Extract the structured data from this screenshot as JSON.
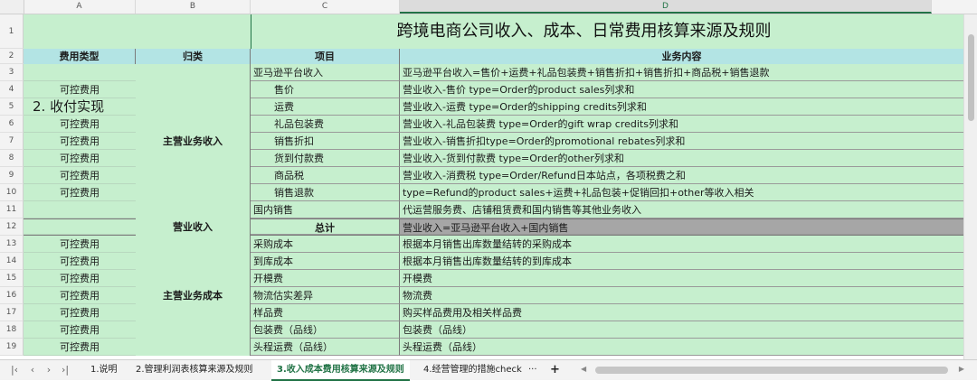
{
  "sheet_title": "跨境电商公司收入、成本、日常费用核算来源及规则",
  "column_headers": [
    "A",
    "B",
    "C",
    "D"
  ],
  "header_row": {
    "col_a": "费用类型",
    "col_b": "归类",
    "col_c": "项目",
    "col_d": "业务内容"
  },
  "section_label": "2.  收付实现",
  "merged_labels": {
    "income": "主营业务收入",
    "revenue": "营业收入",
    "cost": "主营业务成本"
  },
  "rows": [
    {
      "num": "1"
    },
    {
      "num": "2"
    },
    {
      "num": "3",
      "a": "",
      "c": "亚马逊平台收入",
      "d": "亚马逊平台收入=售价+运费+礼品包装费+销售折扣+销售折扣+商品税+销售退款"
    },
    {
      "num": "4",
      "a": "可控费用",
      "c": "售价",
      "d": "营业收入-售价 type=Order的product sales列求和"
    },
    {
      "num": "5",
      "a": "",
      "c": "运费",
      "d": "营业收入-运费 type=Order的shipping credits列求和"
    },
    {
      "num": "6",
      "a": "可控费用",
      "c": "礼品包装费",
      "d": "营业收入-礼品包装费 type=Order的gift wrap credits列求和"
    },
    {
      "num": "7",
      "a": "可控费用",
      "c": "销售折扣",
      "d": "营业收入-销售折扣type=Order的promotional rebates列求和"
    },
    {
      "num": "8",
      "a": "可控费用",
      "c": "货到付款费",
      "d": "营业收入-货到付款费 type=Order的other列求和"
    },
    {
      "num": "9",
      "a": "可控费用",
      "c": "商品税",
      "d": "营业收入-消费税 type=Order/Refund日本站点，各项税费之和"
    },
    {
      "num": "10",
      "a": "可控费用",
      "c": "销售退款",
      "d": "type=Refund的product sales+运费+礼品包装+促销回扣+other等收入相关"
    },
    {
      "num": "11",
      "a": "",
      "c": "国内销售",
      "d": "代运营服务费、店铺租赁费和国内销售等其他业务收入"
    },
    {
      "num": "12",
      "a": "",
      "c": "总计",
      "d": "营业收入=亚马逊平台收入+国内销售"
    },
    {
      "num": "13",
      "a": "可控费用",
      "c": "采购成本",
      "d": "根据本月销售出库数量结转的采购成本"
    },
    {
      "num": "14",
      "a": "可控费用",
      "c": "到库成本",
      "d": "根据本月销售出库数量结转的到库成本"
    },
    {
      "num": "15",
      "a": "可控费用",
      "c": "开模费",
      "d": "开模费"
    },
    {
      "num": "16",
      "a": "可控费用",
      "c": "物流估实差异",
      "d": "物流费"
    },
    {
      "num": "17",
      "a": "可控费用",
      "c": "样品费",
      "d": "购买样品费用及相关样品费"
    },
    {
      "num": "18",
      "a": "可控费用",
      "c": "包装费（品线）",
      "d": "包装费（品线）"
    },
    {
      "num": "19",
      "a": "可控费用",
      "c": "头程运费（品线）",
      "d": "头程运费（品线）"
    }
  ],
  "tabs": [
    {
      "label": "1.说明"
    },
    {
      "label": "2.管理利润表核算来源及规则"
    },
    {
      "label": "3.收入成本费用核算来源及规则",
      "active": true
    },
    {
      "label": "4.经营管理的措施check"
    }
  ],
  "tab_more": "···",
  "tab_add": "+",
  "colors": {
    "green": "#c6efce",
    "header": "#b3e4e4",
    "total": "#a6a6a6",
    "active_tab": "#217346"
  }
}
